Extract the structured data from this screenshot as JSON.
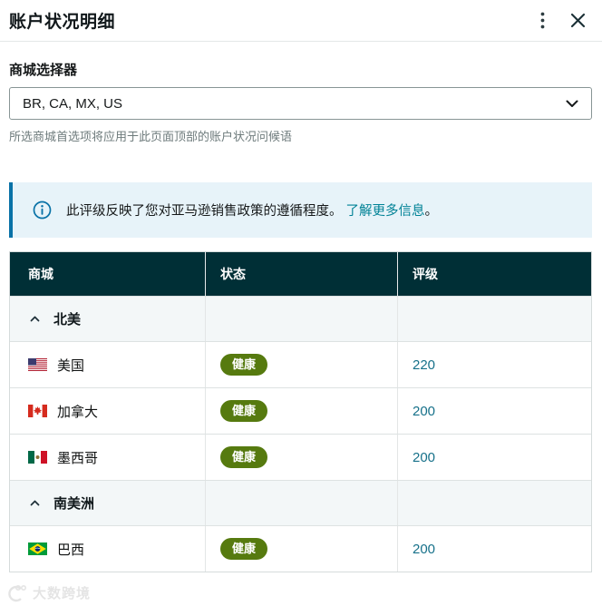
{
  "modal": {
    "title": "账户状况明细"
  },
  "selector": {
    "label": "商城选择器",
    "value": "BR, CA, MX, US",
    "helper": "所选商城首选项将应用于此页面顶部的账户状况问候语"
  },
  "banner": {
    "text": "此评级反映了您对亚马逊销售政策的遵循程度。",
    "link_label": "了解更多信息",
    "suffix": "。"
  },
  "table": {
    "headers": [
      "商城",
      "状态",
      "评级"
    ],
    "header_keys": [
      "marketplace",
      "status",
      "rating"
    ],
    "rows": [
      {
        "type": "group",
        "label": "北美"
      },
      {
        "type": "data",
        "country": "美国",
        "flag": "us",
        "status": "健康",
        "rating": "220"
      },
      {
        "type": "data",
        "country": "加拿大",
        "flag": "ca",
        "status": "健康",
        "rating": "200"
      },
      {
        "type": "data",
        "country": "墨西哥",
        "flag": "mx",
        "status": "健康",
        "rating": "200"
      },
      {
        "type": "group",
        "label": "南美洲"
      },
      {
        "type": "data",
        "country": "巴西",
        "flag": "br",
        "status": "健康",
        "rating": "200"
      }
    ]
  },
  "watermark": {
    "text": "大数跨境"
  },
  "colors": {
    "header_bg": "#002F36",
    "badge_green": "#567A0F",
    "link_teal": "#008296",
    "rating_teal": "#17718A",
    "banner_bg": "#E7F3F9",
    "banner_border": "#0972A7"
  }
}
